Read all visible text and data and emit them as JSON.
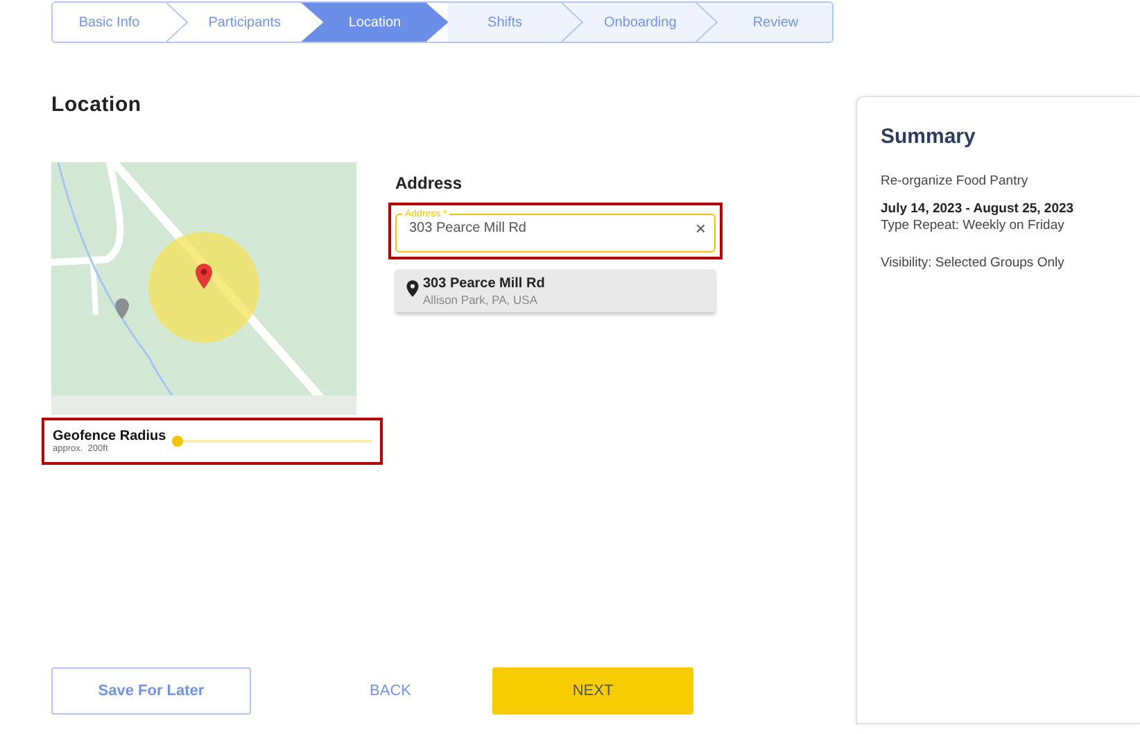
{
  "steps": [
    {
      "label": "Basic Info",
      "selected": false,
      "completed": true
    },
    {
      "label": "Participants",
      "selected": false,
      "completed": true
    },
    {
      "label": "Location",
      "selected": true,
      "completed": false
    },
    {
      "label": "Shifts",
      "selected": false,
      "completed": false
    },
    {
      "label": "Onboarding",
      "selected": false,
      "completed": false
    },
    {
      "label": "Review",
      "selected": false,
      "completed": false
    }
  ],
  "heading": "Location",
  "geofence": {
    "label": "Geofence Radius",
    "hint": "approx.  200ft",
    "level": 0,
    "highlighted": true
  },
  "address": {
    "heading": "Address",
    "field_label": "Address *",
    "value": "303 Pearce Mill Rd",
    "clear": "×",
    "highlighted": true,
    "suggestions": [
      {
        "title": "303 Pearce Mill Rd",
        "subtitle": "Allison Park, PA, USA"
      }
    ]
  },
  "summary": {
    "title": "Summary",
    "event": "Re-organize Food Pantry",
    "dates": "July 14, 2023 - August 25, 2023",
    "repeat": "Type Repeat: Weekly on Friday",
    "visibility": "Visibility: Selected Groups Only"
  },
  "buttons": [
    {
      "label": "Save For Later",
      "kind": "outline"
    },
    {
      "label": "BACK",
      "kind": "text"
    },
    {
      "label": "NEXT",
      "kind": "primary"
    }
  ]
}
